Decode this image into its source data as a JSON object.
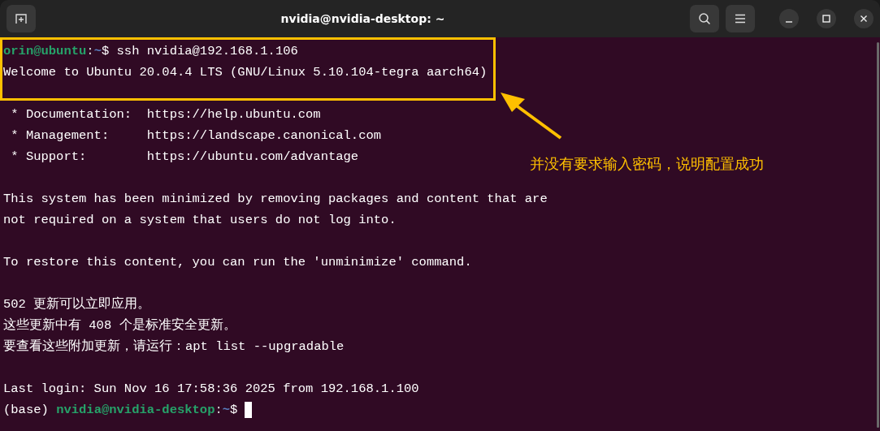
{
  "window": {
    "title": "nvidia@nvidia-desktop: ~"
  },
  "terminal": {
    "lines": [
      {
        "kind": "prompt",
        "user_host": "orin@ubuntu",
        "separator": ":",
        "path": "~",
        "command": "$ ssh nvidia@192.168.1.106"
      },
      {
        "kind": "text",
        "text": "Welcome to Ubuntu 20.04.4 LTS (GNU/Linux 5.10.104-tegra aarch64)"
      },
      {
        "kind": "blank"
      },
      {
        "kind": "text",
        "text": " * Documentation:  https://help.ubuntu.com"
      },
      {
        "kind": "text",
        "text": " * Management:     https://landscape.canonical.com"
      },
      {
        "kind": "text",
        "text": " * Support:        https://ubuntu.com/advantage"
      },
      {
        "kind": "blank"
      },
      {
        "kind": "text",
        "text": "This system has been minimized by removing packages and content that are"
      },
      {
        "kind": "text",
        "text": "not required on a system that users do not log into."
      },
      {
        "kind": "blank"
      },
      {
        "kind": "text",
        "text": "To restore this content, you can run the 'unminimize' command."
      },
      {
        "kind": "blank"
      },
      {
        "kind": "text",
        "text": "502 更新可以立即应用。"
      },
      {
        "kind": "text",
        "text": "这些更新中有 408 个是标准安全更新。"
      },
      {
        "kind": "text",
        "text": "要查看这些附加更新，请运行：apt list --upgradable"
      },
      {
        "kind": "blank"
      },
      {
        "kind": "text",
        "text": "Last login: Sun Nov 16 17:58:36 2025 from 192.168.1.100"
      },
      {
        "kind": "prompt",
        "prefix": "(base) ",
        "user_host": "nvidia@nvidia-desktop",
        "separator": ":",
        "path": "~",
        "command": "$",
        "cursor": true
      }
    ]
  },
  "annotation": {
    "text": "并没有要求输入密码，说明配置成功"
  }
}
